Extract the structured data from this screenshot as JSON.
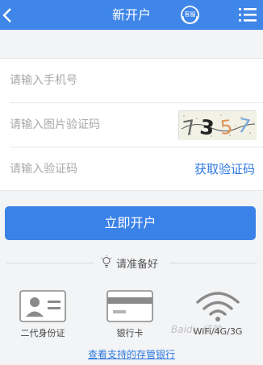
{
  "header": {
    "title": "新开户",
    "service_label": "客服",
    "background_color": "#3f86e8"
  },
  "form": {
    "phone_placeholder": "请输入手机号",
    "captcha_placeholder": "请输入图片验证码",
    "captcha_text": "7357",
    "sms_code_placeholder": "请输入验证码",
    "get_code_label": "获取验证码"
  },
  "primary_button": {
    "label": "立即开户",
    "color": "#3b82e8"
  },
  "prepare": {
    "label": "请准备好",
    "icon": "lightbulb-icon"
  },
  "requirements": [
    {
      "label": "二代身份证",
      "icon": "id-card-icon"
    },
    {
      "label": "银行卡",
      "icon": "bank-card-icon"
    },
    {
      "label": "WiFi/4G/3G",
      "icon": "wifi-icon"
    }
  ],
  "link": {
    "label": "查看支持的存管银行"
  },
  "watermark": "Baidu 经验",
  "accent_link_color": "#2e78de"
}
